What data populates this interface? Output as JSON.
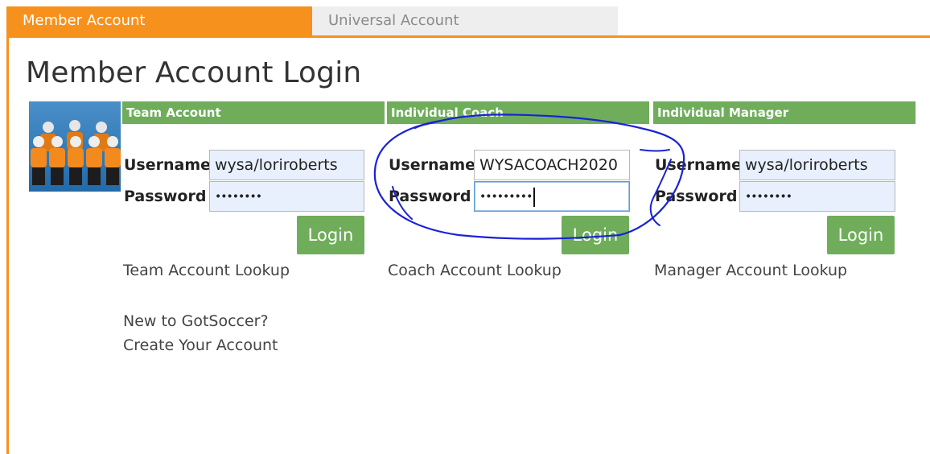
{
  "tabs": [
    {
      "label": "Member Account",
      "active": true
    },
    {
      "label": "Universal Account",
      "active": false
    }
  ],
  "page_title": "Member Account Login",
  "columns": [
    {
      "header": "Team Account",
      "username_label": "Username",
      "username_value": "wysa/loriroberts",
      "password_label": "Password",
      "password_masked": "••••••••",
      "login_label": "Login",
      "lookup_label": "Team Account Lookup"
    },
    {
      "header": "Individual Coach",
      "username_label": "Username",
      "username_value": "WYSACOACH2020",
      "password_label": "Password",
      "password_masked": "•••••••••",
      "login_label": "Login",
      "lookup_label": "Coach Account Lookup"
    },
    {
      "header": "Individual Manager",
      "username_label": "Username",
      "username_value": "wysa/loriroberts",
      "password_label": "Password",
      "password_masked": "••••••••",
      "login_label": "Login",
      "lookup_label": "Manager Account Lookup"
    }
  ],
  "new_user": {
    "question": "New to GotSoccer?",
    "create_link": "Create Your Account"
  },
  "colors": {
    "accent_orange": "#f7911d",
    "header_green": "#6fad5b",
    "annotation_blue": "#1a22d6"
  },
  "icons": {
    "team_image": "team-players-icon"
  }
}
